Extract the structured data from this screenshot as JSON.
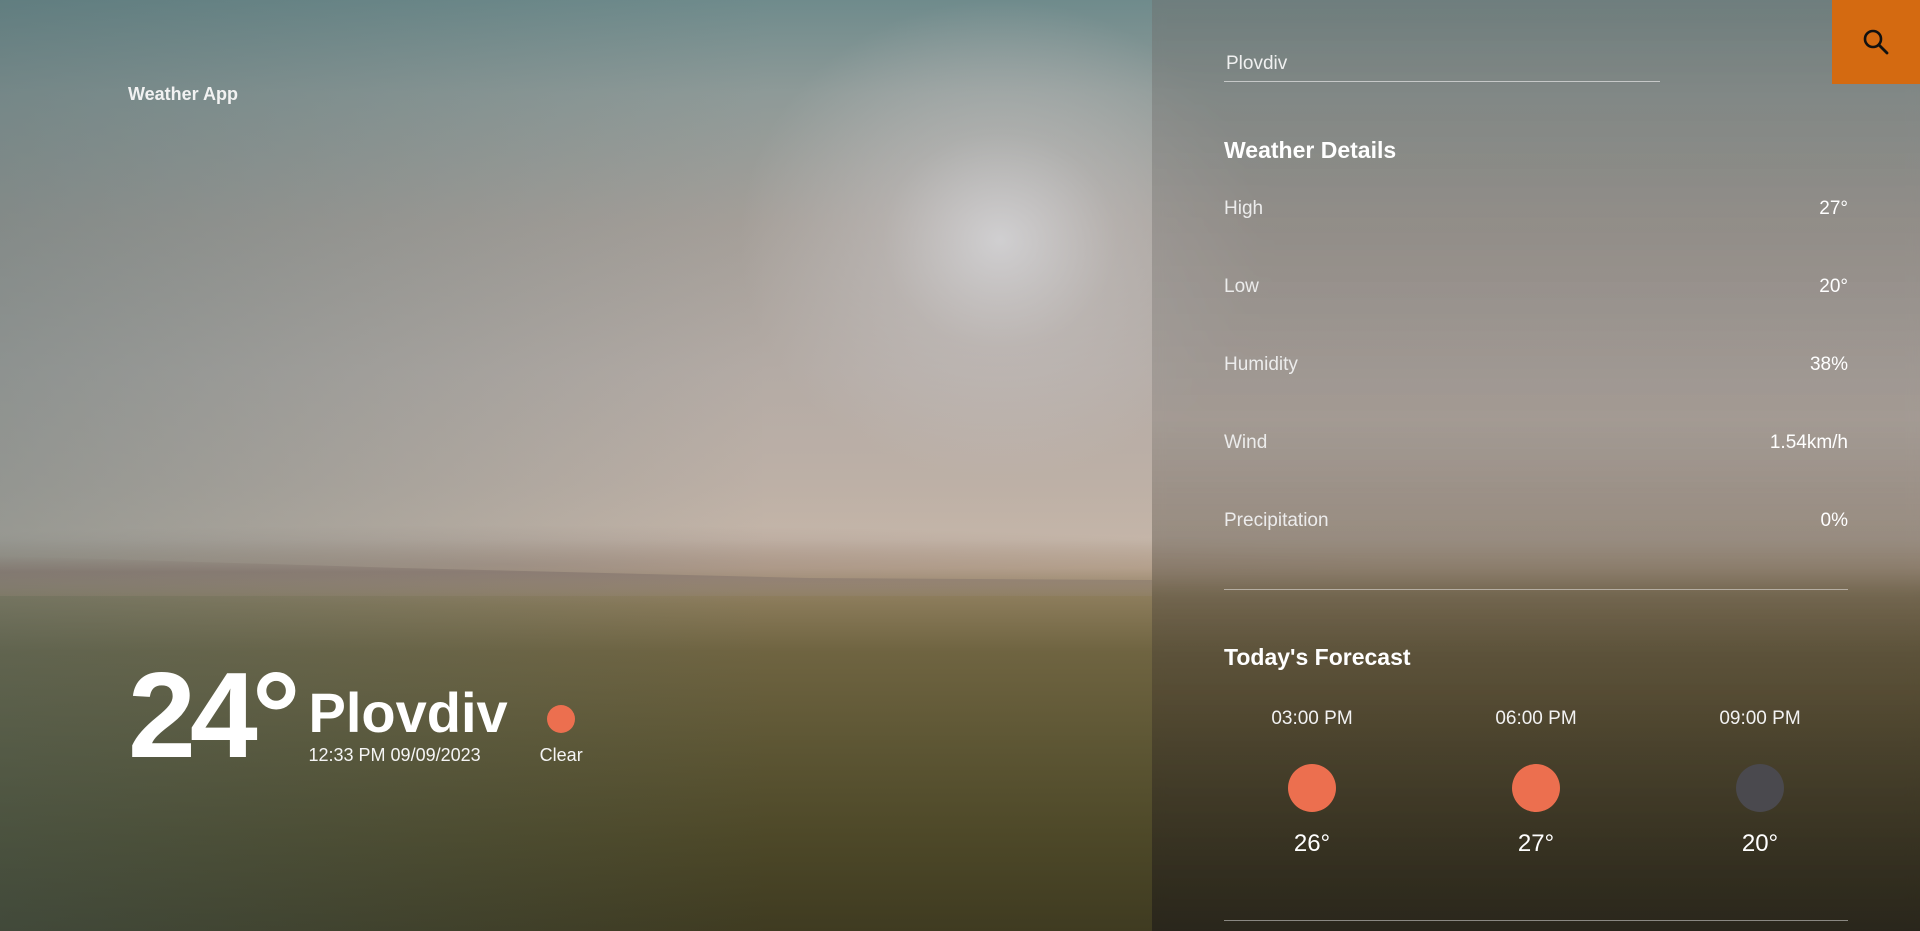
{
  "app": {
    "brand": "Weather App"
  },
  "current": {
    "temperature": "24°",
    "city": "Plovdiv",
    "datetime": "12:33 PM 09/09/2023",
    "condition": "Clear",
    "condition_icon": "sun-icon",
    "condition_color": "#ec6f4f"
  },
  "search": {
    "value": "Plovdiv",
    "placeholder": "Plovdiv",
    "button_icon": "search-icon",
    "button_color": "#d46a11"
  },
  "details": {
    "title": "Weather Details",
    "rows": [
      {
        "label": "High",
        "value": "27°"
      },
      {
        "label": "Low",
        "value": "20°"
      },
      {
        "label": "Humidity",
        "value": "38%"
      },
      {
        "label": "Wind",
        "value": "1.54km/h"
      },
      {
        "label": "Precipitation",
        "value": "0%"
      }
    ]
  },
  "forecast": {
    "title": "Today's Forecast",
    "items": [
      {
        "time": "03:00 PM",
        "temp": "26°",
        "icon": "sun-icon",
        "color": "#ec6f4f"
      },
      {
        "time": "06:00 PM",
        "temp": "27°",
        "icon": "sun-icon",
        "color": "#ec6f4f"
      },
      {
        "time": "09:00 PM",
        "temp": "20°",
        "icon": "moon-icon",
        "color": "#4a494e"
      }
    ]
  }
}
